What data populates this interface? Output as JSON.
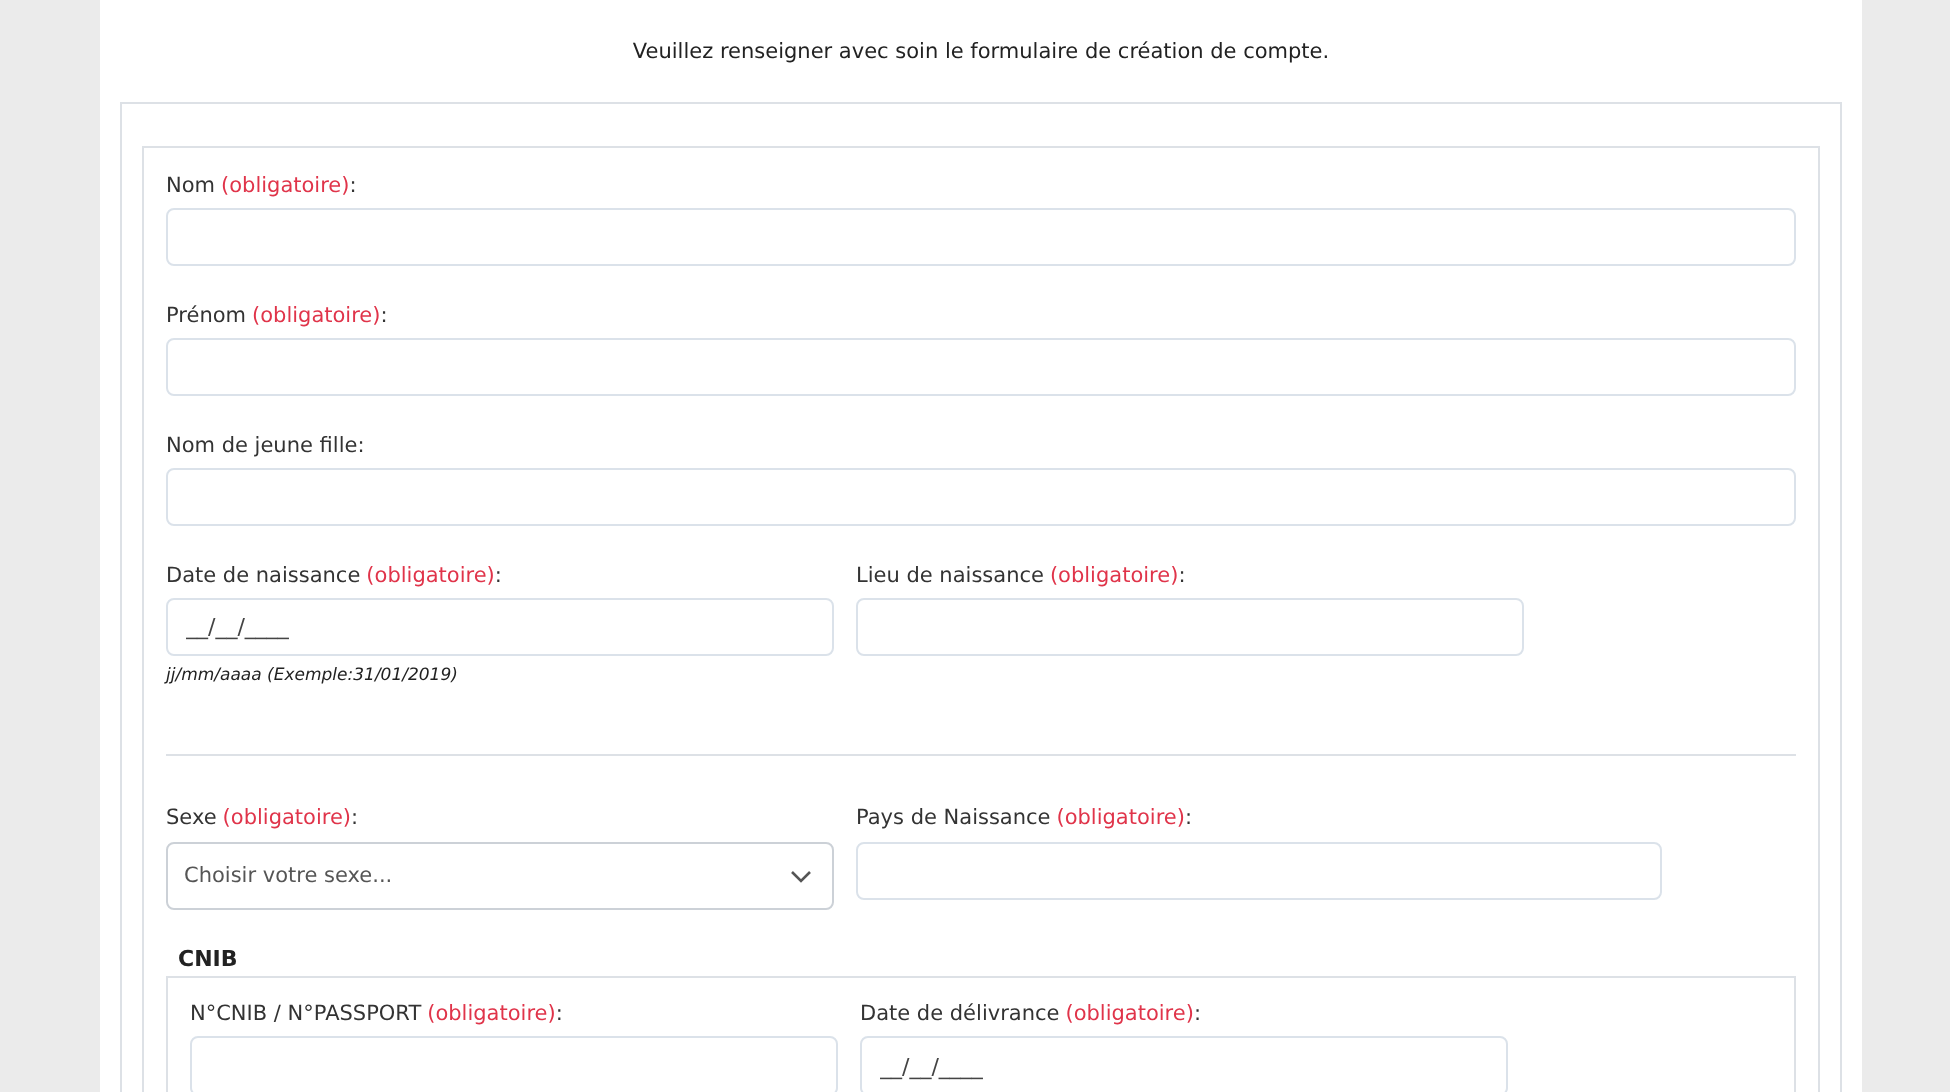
{
  "intro": "Veuillez renseigner avec soin le formulaire de création de compte.",
  "fields": [
    {
      "label": "Nom",
      "note": "(obligatoire)",
      "end": ":"
    },
    {
      "label": "Prénom",
      "note": "(obligatoire)",
      "end": ":"
    },
    {
      "label": "Nom de jeune fille:"
    }
  ],
  "row1": [
    {
      "label": "Date de naissance",
      "note": "(obligatoire)",
      "end": ":",
      "placeholder": "__/__/____",
      "hint": "jj/mm/aaaa (Exemple:31/01/2019)"
    },
    {
      "label": "Lieu de naissance",
      "note": "(obligatoire)",
      "end": ":"
    }
  ],
  "row2": [
    {
      "kind": "select",
      "label": "Sexe",
      "note": "(obligatoire)",
      "end": ":",
      "placeholder": "Choisir votre sexe..."
    },
    {
      "kind": "text",
      "label": "Pays de Naissance",
      "note": "(obligatoire)",
      "end": ":"
    }
  ],
  "cnib": {
    "title": "CNIB",
    "fields": [
      {
        "label": "N°CNIB / N°PASSPORT",
        "note": "(obligatoire)",
        "end": ":"
      },
      {
        "label": "Date de délivrance",
        "note": "(obligatoire)",
        "end": ":",
        "placeholder": "__/__/____"
      }
    ]
  }
}
